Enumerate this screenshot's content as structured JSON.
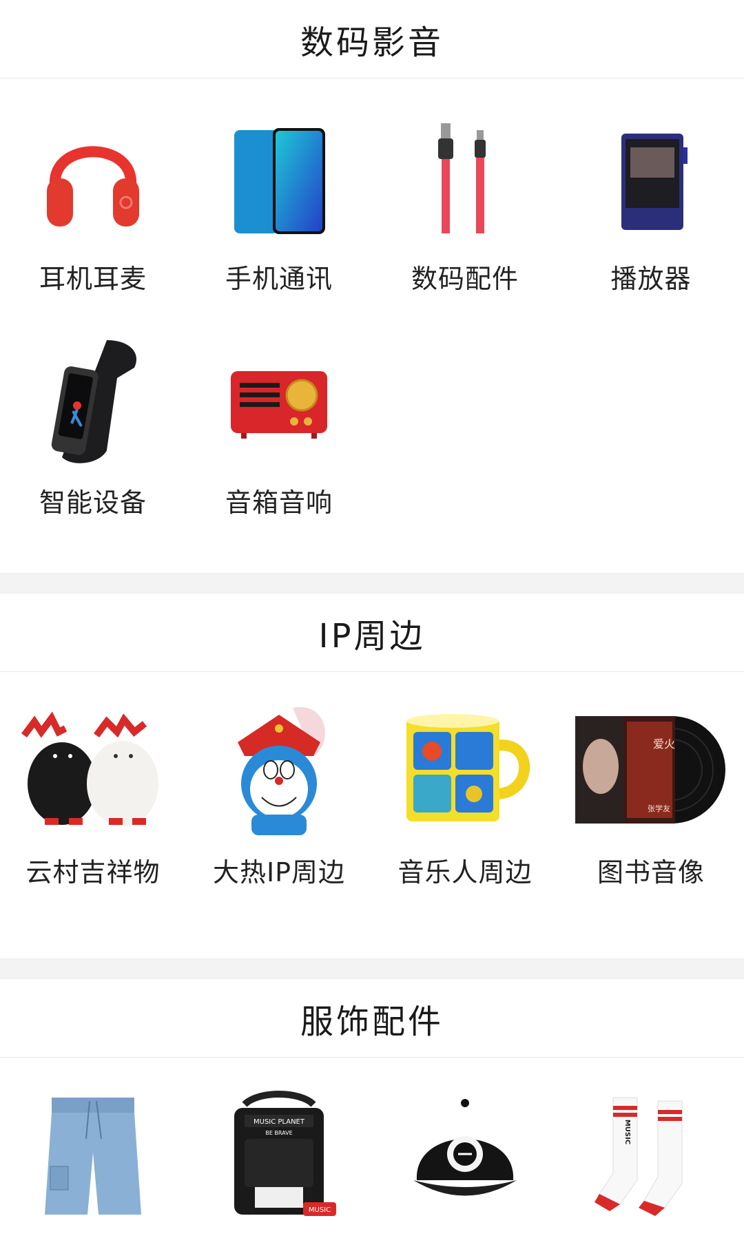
{
  "sections": [
    {
      "title": "数码影音",
      "items": [
        {
          "label": "耳机耳麦",
          "icon": "headphones-icon"
        },
        {
          "label": "手机通讯",
          "icon": "smartphone-icon"
        },
        {
          "label": "数码配件",
          "icon": "usb-cable-icon"
        },
        {
          "label": "播放器",
          "icon": "music-player-icon"
        },
        {
          "label": "智能设备",
          "icon": "smart-band-icon"
        },
        {
          "label": "音箱音响",
          "icon": "radio-speaker-icon"
        }
      ]
    },
    {
      "title": "IP周边",
      "items": [
        {
          "label": "云村吉祥物",
          "icon": "mascot-plush-icon"
        },
        {
          "label": "大热IP周边",
          "icon": "doraemon-icon"
        },
        {
          "label": "音乐人周边",
          "icon": "mug-icon"
        },
        {
          "label": "图书音像",
          "icon": "vinyl-record-icon",
          "album_text": [
            "张学友",
            "爱火"
          ]
        }
      ]
    },
    {
      "title": "服饰配件",
      "items": [
        {
          "label": "",
          "icon": "shorts-icon"
        },
        {
          "label": "",
          "icon": "shoulder-bag-icon",
          "print": [
            "MUSIC PLANET",
            "BE BRAVE",
            "MUSIC"
          ]
        },
        {
          "label": "",
          "icon": "cap-icon"
        },
        {
          "label": "",
          "icon": "socks-icon",
          "print": [
            "MUSIC"
          ]
        }
      ]
    }
  ],
  "colors": {
    "accent_red": "#e8342e",
    "divider": "#e8e8e8",
    "gap_bg": "#f3f3f3"
  }
}
